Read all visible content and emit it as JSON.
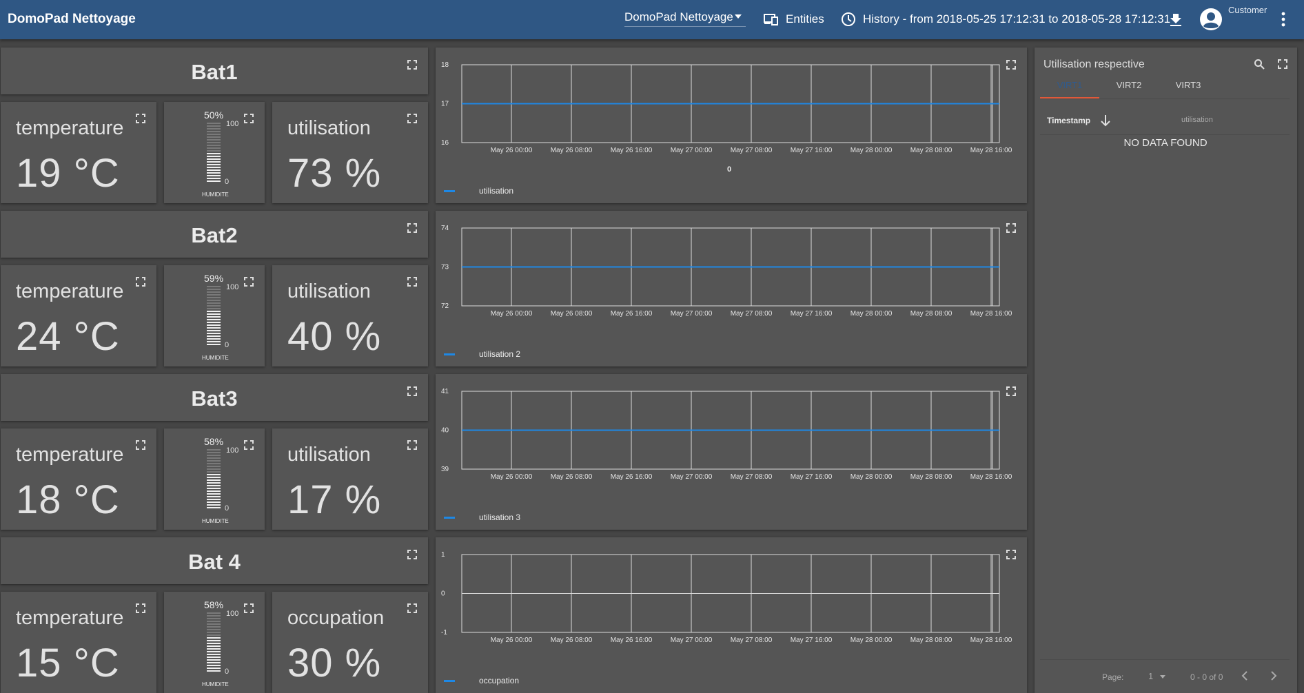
{
  "header": {
    "title": "DomoPad Nettoyage",
    "dashboard_select": "DomoPad Nettoyage",
    "entities_label": "Entities",
    "history_label": "History - from 2018-05-25 17:12:31 to 2018-05-28 17:12:31",
    "user_label": "Customer"
  },
  "rows": [
    {
      "name": "Bat1",
      "temp_label": "temperature",
      "temp_value": "19 °C",
      "humid_pct": "50%",
      "humid_level": 0.5,
      "humid_max": "100",
      "humid_min": "0",
      "humid_label": "HUMIDITE",
      "util_label": "utilisation",
      "util_value": "73 %",
      "chart_extra": "0"
    },
    {
      "name": "Bat2",
      "temp_label": "temperature",
      "temp_value": "24 °C",
      "humid_pct": "59%",
      "humid_level": 0.59,
      "humid_max": "100",
      "humid_min": "0",
      "humid_label": "HUMIDITE",
      "util_label": "utilisation",
      "util_value": "40 %",
      "chart_extra": ""
    },
    {
      "name": "Bat3",
      "temp_label": "temperature",
      "temp_value": "18 °C",
      "humid_pct": "58%",
      "humid_level": 0.58,
      "humid_max": "100",
      "humid_min": "0",
      "humid_label": "HUMIDITE",
      "util_label": "utilisation",
      "util_value": "17 %",
      "chart_extra": ""
    },
    {
      "name": "Bat 4",
      "temp_label": "temperature",
      "temp_value": "15 °C",
      "humid_pct": "58%",
      "humid_level": 0.58,
      "humid_max": "100",
      "humid_min": "0",
      "humid_label": "HUMIDITE",
      "util_label": "occupation",
      "util_value": "30 %",
      "chart_extra": ""
    }
  ],
  "chart_data": [
    {
      "type": "line",
      "x": [
        "May 26 00:00",
        "May 26 08:00",
        "May 26 16:00",
        "May 27 00:00",
        "May 27 08:00",
        "May 27 16:00",
        "May 28 00:00",
        "May 28 08:00",
        "May 28 16:00"
      ],
      "series": [
        {
          "name": "utilisation",
          "values": [
            17,
            17,
            17,
            17,
            17,
            17,
            17,
            17,
            17
          ]
        }
      ],
      "ylim": [
        16,
        18
      ],
      "yticks": [
        "16",
        "17",
        "18"
      ],
      "color": "#1e88e5",
      "legend": "bottom-left",
      "grid": true
    },
    {
      "type": "line",
      "x": [
        "May 26 00:00",
        "May 26 08:00",
        "May 26 16:00",
        "May 27 00:00",
        "May 27 08:00",
        "May 27 16:00",
        "May 28 00:00",
        "May 28 08:00",
        "May 28 16:00"
      ],
      "series": [
        {
          "name": "utilisation 2",
          "values": [
            73,
            73,
            73,
            73,
            73,
            73,
            73,
            73,
            73
          ]
        }
      ],
      "ylim": [
        72,
        74
      ],
      "yticks": [
        "72",
        "73",
        "74"
      ],
      "color": "#1e88e5",
      "legend": "bottom-left",
      "grid": true
    },
    {
      "type": "line",
      "x": [
        "May 26 00:00",
        "May 26 08:00",
        "May 26 16:00",
        "May 27 00:00",
        "May 27 08:00",
        "May 27 16:00",
        "May 28 00:00",
        "May 28 08:00",
        "May 28 16:00"
      ],
      "series": [
        {
          "name": "utilisation 3",
          "values": [
            40,
            40,
            40,
            40,
            40,
            40,
            40,
            40,
            40
          ]
        }
      ],
      "ylim": [
        39,
        41
      ],
      "yticks": [
        "39",
        "40",
        "41"
      ],
      "color": "#1e88e5",
      "legend": "bottom-left",
      "grid": true
    },
    {
      "type": "line",
      "x": [
        "May 26 00:00",
        "May 26 08:00",
        "May 26 16:00",
        "May 27 00:00",
        "May 27 08:00",
        "May 27 16:00",
        "May 28 00:00",
        "May 28 08:00",
        "May 28 16:00"
      ],
      "series": [
        {
          "name": "occupation",
          "values": []
        }
      ],
      "ylim": [
        -1,
        1
      ],
      "yticks": [
        "-1",
        "0",
        "1"
      ],
      "color": "#1e88e5",
      "legend": "bottom-left",
      "grid": true
    }
  ],
  "table": {
    "title": "Utilisation respective",
    "tabs": [
      "VIRT1",
      "VIRT2",
      "VIRT3"
    ],
    "active_tab": 0,
    "col_timestamp": "Timestamp",
    "col_utilisation": "utilisation",
    "no_data": "NO DATA FOUND",
    "page_label": "Page:",
    "page_value": "1",
    "page_range": "0 - 0 of 0"
  },
  "colors": {
    "header": "#2f5784",
    "panel": "#555555",
    "series": "#1e88e5",
    "tab_accent": "#e0593a"
  }
}
